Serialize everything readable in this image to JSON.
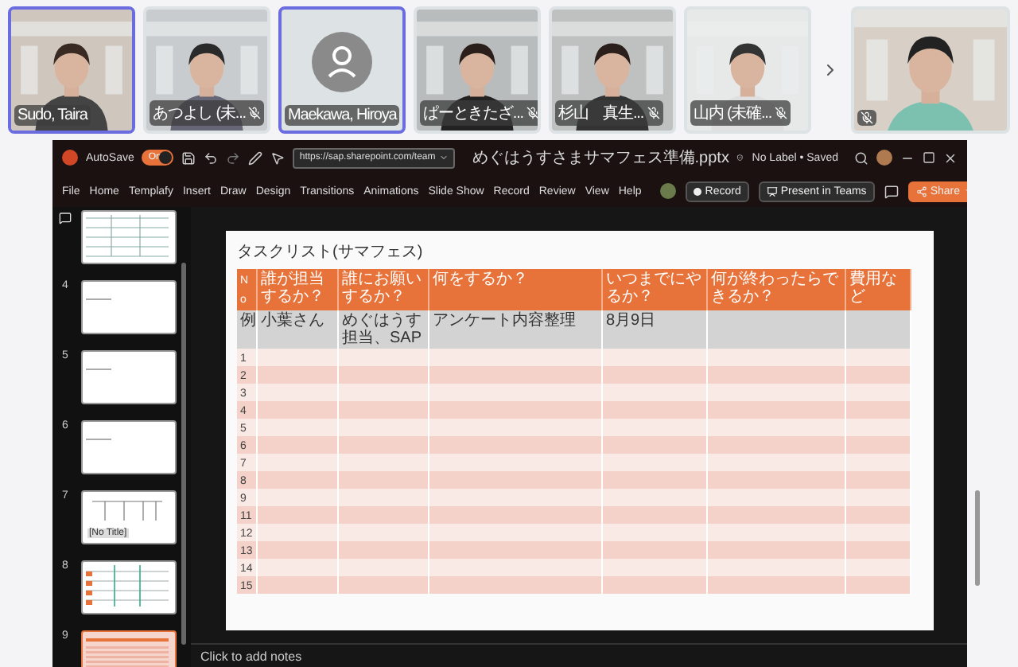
{
  "participants": [
    {
      "name": "Sudo, Taira",
      "kind": "video",
      "highlighted": true,
      "muted": false
    },
    {
      "name": "あつよし (未...",
      "kind": "video",
      "highlighted": false,
      "muted": true
    },
    {
      "name": "Maekawa, Hiroya",
      "kind": "avatar",
      "highlighted": true,
      "muted": false
    },
    {
      "name": "ぱーときたざ...",
      "kind": "video",
      "highlighted": false,
      "muted": true
    },
    {
      "name": "杉山　真生...",
      "kind": "video",
      "highlighted": false,
      "muted": true
    },
    {
      "name": "山内 (未確...",
      "kind": "video",
      "highlighted": false,
      "muted": true
    }
  ],
  "featured": {
    "kind": "video",
    "muted": true
  },
  "window": {
    "autosave": {
      "label": "AutoSave",
      "toggle": "On",
      "on": true
    },
    "url": "https://sap.sharepoint.com/team",
    "filename": "めぐはうすさまサマフェス準備.pptx",
    "status": "No Label • Saved"
  },
  "menu": [
    {
      "label": "File"
    },
    {
      "label": "Home"
    },
    {
      "label": "Templafy"
    },
    {
      "label": "Insert"
    },
    {
      "label": "Draw"
    },
    {
      "label": "Design"
    },
    {
      "label": "Transitions"
    },
    {
      "label": "Animations"
    },
    {
      "label": "Slide Show"
    },
    {
      "label": "Record"
    },
    {
      "label": "Review"
    },
    {
      "label": "View"
    },
    {
      "label": "Help"
    }
  ],
  "actions": {
    "record": "Record",
    "present": "Present in Teams",
    "share": "Share"
  },
  "thumbnails": [
    {
      "kind": "table",
      "selected": false
    },
    {
      "number": "4",
      "kind": "blank",
      "selected": false
    },
    {
      "number": "5",
      "kind": "blank",
      "selected": false
    },
    {
      "number": "6",
      "kind": "blank",
      "selected": false
    },
    {
      "number": "7",
      "kind": "diagram",
      "label": "[No Title]",
      "selected": false
    },
    {
      "number": "8",
      "kind": "grid",
      "selected": false
    },
    {
      "number": "9",
      "kind": "lined",
      "selected": true
    }
  ],
  "slide": {
    "title": "タスクリスト(サマフェス)",
    "columns": [
      "No",
      "誰が担当するか？",
      "誰にお願いするか？",
      "何をするか？",
      "いつまでにやるか？",
      "何が終わったらできるか？",
      "費用など"
    ],
    "rows": [
      [
        "例",
        "小葉さん",
        "めぐはうす担当、SAP",
        "アンケート内容整理",
        "8月9日",
        "",
        ""
      ],
      [
        "1"
      ],
      [
        "2"
      ],
      [
        "3"
      ],
      [
        "4"
      ],
      [
        "5"
      ],
      [
        "6"
      ],
      [
        "7"
      ],
      [
        "8"
      ],
      [
        "9"
      ],
      [
        "11"
      ],
      [
        "12"
      ],
      [
        "13"
      ],
      [
        "14"
      ],
      [
        "15"
      ]
    ]
  },
  "notes": "Click to add notes"
}
